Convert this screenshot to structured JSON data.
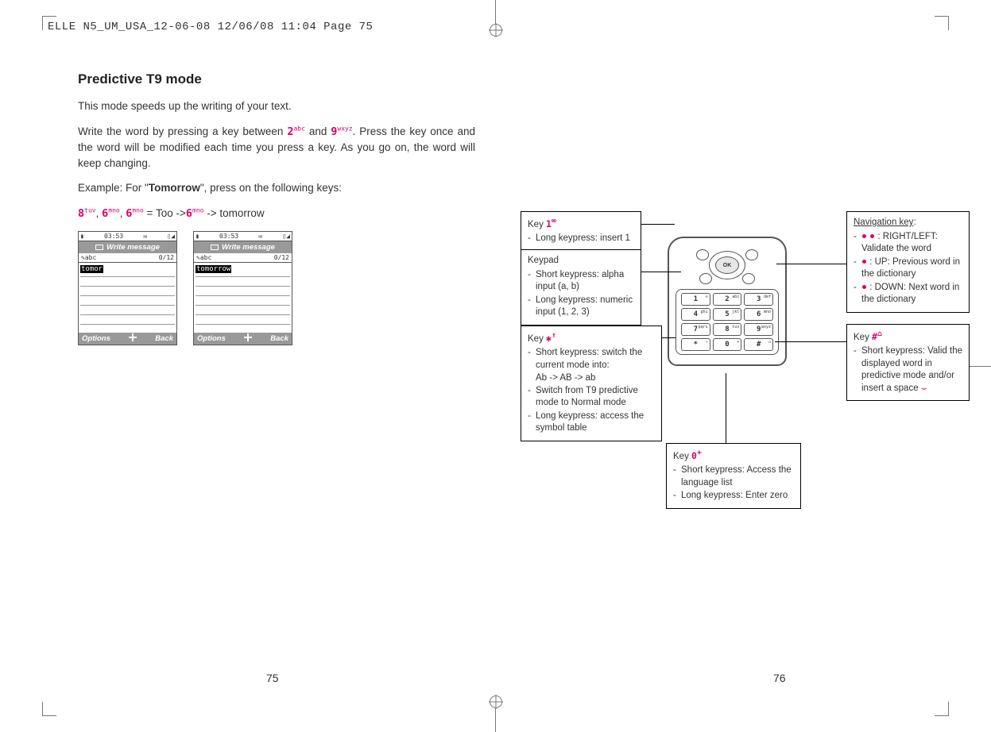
{
  "slugline": "ELLE N5_UM_USA_12-06-08  12/06/08  11:04  Page 75",
  "section_title": "Predictive T9 mode",
  "para1": "This mode speeds up the writing of your text.",
  "para2_pre": "Write the word by pressing a key between ",
  "para2_key2": "2",
  "para2_sup2": "abc",
  "para2_mid": " and ",
  "para2_key9": "9",
  "para2_sup9": "wxyz",
  "para2_post": ". Press the key once and the word will be modified each time you press a key. As you go on, the word will keep changing.",
  "para3_pre": "Example: For \"",
  "para3_bold": "Tomorrow",
  "para3_post": "\", press on the following keys:",
  "seq": {
    "k1": "8",
    "s1": "tuv",
    "k2": "6",
    "s2": "mno",
    "k3": "6",
    "s3": "mno",
    "mid1": " = Too ->",
    "k4": "6",
    "s4": "mno",
    "mid2": " -> tomorrow"
  },
  "screens": {
    "time": "03:53",
    "title": "Write message",
    "mode": "abc",
    "count": "0/12",
    "text1": "tomor",
    "text2": "tomorrow",
    "options": "Options",
    "back": "Back"
  },
  "keypad": {
    "keys": [
      "1",
      "2",
      "3",
      "4",
      "5",
      "6",
      "7",
      "8",
      "9",
      "*",
      "0",
      "#"
    ],
    "sups": [
      "∞",
      "abc",
      "def",
      "ghi",
      "jkl",
      "mno",
      "pqrs",
      "tuv",
      "wxyz",
      "↑",
      "+",
      "⌂"
    ],
    "ok": "OK"
  },
  "callouts": {
    "key1": {
      "head": "Key ",
      "icon": "1",
      "iconSup": "∞",
      "items": [
        "Long keypress: insert 1"
      ]
    },
    "keypad": {
      "head": "Keypad",
      "items": [
        "Short keypress: alpha input (a, b)",
        "Long keypress: numeric input (1, 2, 3)"
      ]
    },
    "keystar": {
      "head": "Key ",
      "icon": "✱",
      "iconSup": "↑",
      "items": [
        "Short keypress: switch the current mode into:",
        "Ab -> AB -> ab",
        "Switch from T9 predictive mode to Normal mode",
        "Long keypress: access the symbol table"
      ]
    },
    "key0": {
      "head": "Key ",
      "icon": "0",
      "iconSup": "+",
      "items": [
        "Short keypress: Access the language list",
        "Long keypress: Enter zero"
      ]
    },
    "nav": {
      "head": "Navigation key",
      "items": [
        ": RIGHT/LEFT: Validate the word",
        ": UP: Previous word in the dictionary",
        ": DOWN: Next word in the dictionary"
      ]
    },
    "keyhash": {
      "head": "Key ",
      "icon": "#",
      "iconSup": "⌂",
      "items": [
        "Short keypress: Valid the displayed word in predictive mode and/or insert a space"
      ]
    }
  },
  "page_left_num": "75",
  "page_right_num": "76"
}
